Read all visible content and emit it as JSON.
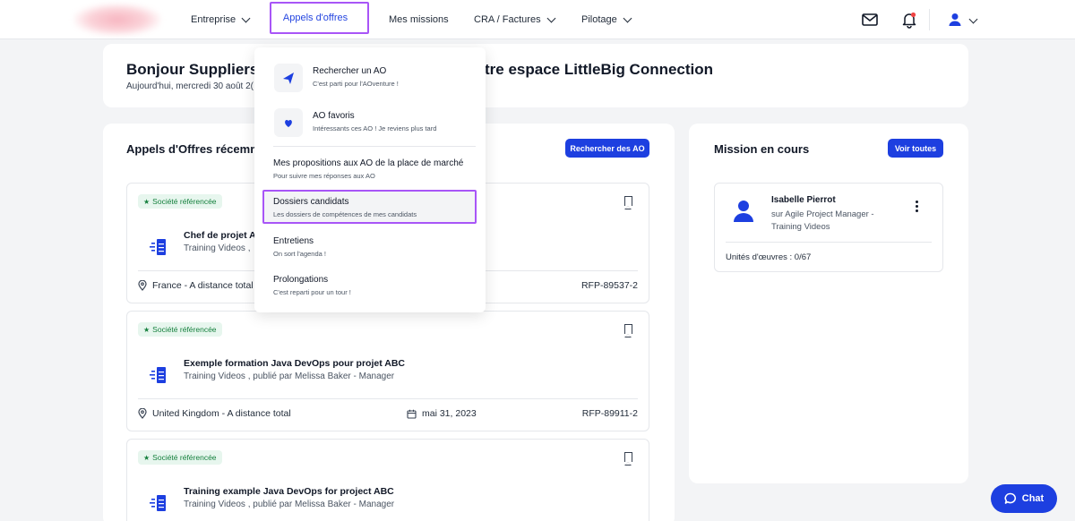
{
  "nav": {
    "items": [
      {
        "label": "Entreprise"
      },
      {
        "label": "Appels d'offres"
      },
      {
        "label": "Mes missions"
      },
      {
        "label": "CRA / Factures"
      },
      {
        "label": "Pilotage"
      }
    ]
  },
  "welcome": {
    "title_left": "Bonjour Suppliers",
    "title_right": "tre espace LittleBig Connection",
    "date": "Aujourd'hui, mercredi 30 août 2("
  },
  "ao_section": {
    "title": "Appels d'Offres récemm",
    "search_button": "Rechercher des AO",
    "cards": [
      {
        "badge": "Société référencée",
        "title": "Chef de projet Ag",
        "subtitle": "Training Videos ,",
        "location": "France - A distance total",
        "date": "",
        "ref": "RFP-89537-2"
      },
      {
        "badge": "Société référencée",
        "title": "Exemple formation Java DevOps pour projet ABC",
        "subtitle": "Training Videos , publié par Melissa Baker - Manager",
        "location": "United Kingdom - A distance total",
        "date": "mai 31, 2023",
        "ref": "RFP-89911-2"
      },
      {
        "badge": "Société référencée",
        "title": "Training example Java DevOps for project ABC",
        "subtitle": "Training Videos , publié par Melissa Baker - Manager",
        "location": "",
        "date": "",
        "ref": ""
      }
    ]
  },
  "mission_section": {
    "title": "Mission en cours",
    "see_all_button": "Voir toutes",
    "mission": {
      "name": "Isabelle Pierrot",
      "role": "sur Agile Project Manager - Training Videos",
      "units": "Unités d'œuvres : 0/67"
    }
  },
  "dropdown": {
    "items": [
      {
        "title": "Rechercher un AO",
        "desc": "C'est parti pour l'AOventure !",
        "icon": "paper-plane-icon"
      },
      {
        "title": "AO favoris",
        "desc": "Intéressants ces AO ! Je reviens plus tard",
        "icon": "heart-icon"
      },
      {
        "title": "Mes propositions aux AO de la place de marché",
        "desc": "Pour suivre mes réponses aux AO"
      },
      {
        "title": "Dossiers candidats",
        "desc": "Les dossiers de compétences de mes candidats"
      },
      {
        "title": "Entretiens",
        "desc": "On sort l'agenda !"
      },
      {
        "title": "Prolongations",
        "desc": "C'est reparti pour un tour !"
      }
    ]
  },
  "chat": {
    "label": "Chat"
  },
  "colors": {
    "primary": "#1d3fe0",
    "highlight": "#a855f7",
    "badge_green": "#15803d"
  }
}
